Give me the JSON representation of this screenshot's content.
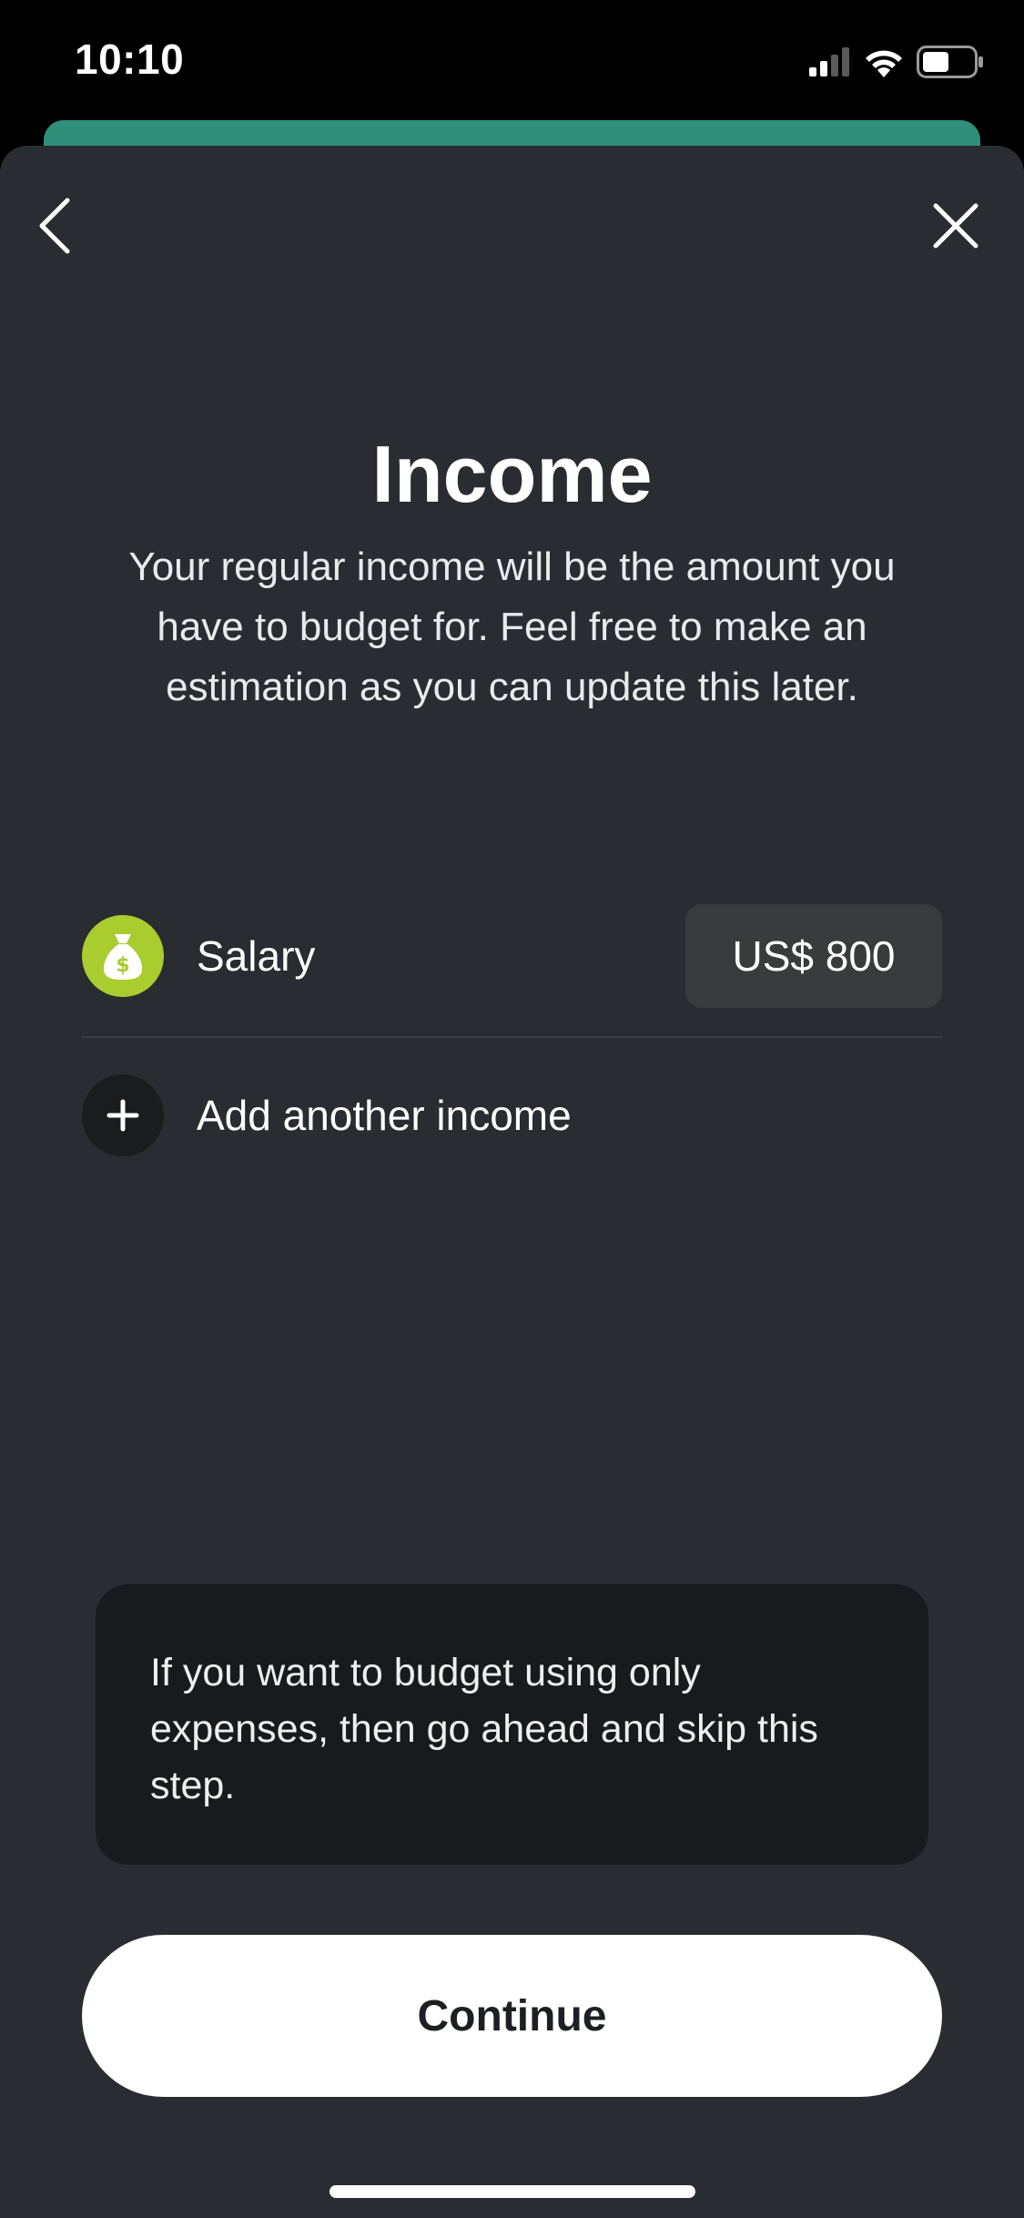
{
  "status_bar": {
    "time": "10:10",
    "icons": [
      "cellular-signal-icon",
      "wifi-icon",
      "battery-icon"
    ]
  },
  "navigation": {
    "back_icon": "chevron-left-icon",
    "close_icon": "close-icon"
  },
  "header": {
    "title": "Income",
    "description": "Your regular income will be the amount you have to budget for. Feel free to make an estimation as you can update this later."
  },
  "income_list": {
    "items": [
      {
        "icon": "money-bag-icon",
        "label": "Salary",
        "amount": "US$ 800"
      }
    ],
    "add_label": "Add another income",
    "add_icon": "plus-icon"
  },
  "tip": {
    "text": "If you want to budget using only expenses, then go ahead and skip this step."
  },
  "actions": {
    "continue_label": "Continue"
  },
  "colors": {
    "sheet_background": "#292c30",
    "peek_sheet": "#2f8f78",
    "salary_icon": "#a9cc2f",
    "amount_pill": "#3a3b3d",
    "tip_card": "#181b1d",
    "primary_button": "#ffffff"
  }
}
